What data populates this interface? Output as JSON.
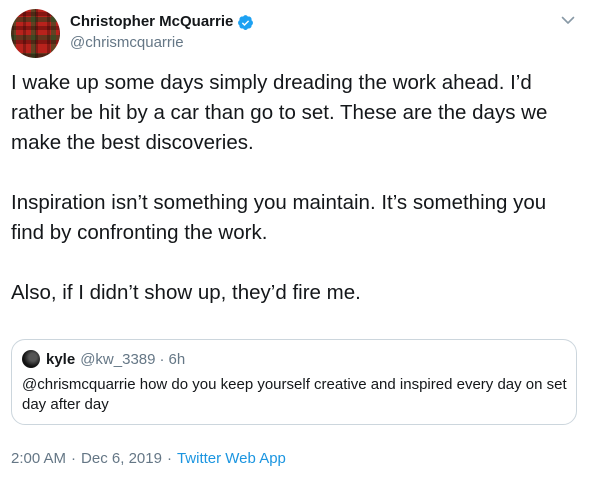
{
  "author": {
    "display_name": "Christopher McQuarrie",
    "handle": "@chrismcquarrie",
    "verified": true
  },
  "tweet": {
    "text": "I wake up some days simply dreading the work ahead. I’d rather be hit by a car than go to set. These are the days we make the best discoveries.\n\nInspiration isn’t something you maintain. It’s something you find by confronting the work.\n\nAlso, if I didn’t show up, they’d fire me."
  },
  "quoted": {
    "display_name": "kyle",
    "handle": "@kw_3389",
    "dot": "·",
    "time": "6h",
    "text": "@chrismcquarrie how do you keep yourself creative and inspired every day on set day after day"
  },
  "meta": {
    "time": "2:00 AM",
    "sep1": "·",
    "date": "Dec 6, 2019",
    "sep2": "·",
    "source": "Twitter Web App"
  },
  "icons": {
    "verified": "verified-badge-icon",
    "caret": "chevron-down-icon"
  },
  "colors": {
    "text": "#14171a",
    "secondary": "#657786",
    "link": "#1b95e0",
    "verified": "#1da1f2",
    "border": "#ccd6dd"
  }
}
